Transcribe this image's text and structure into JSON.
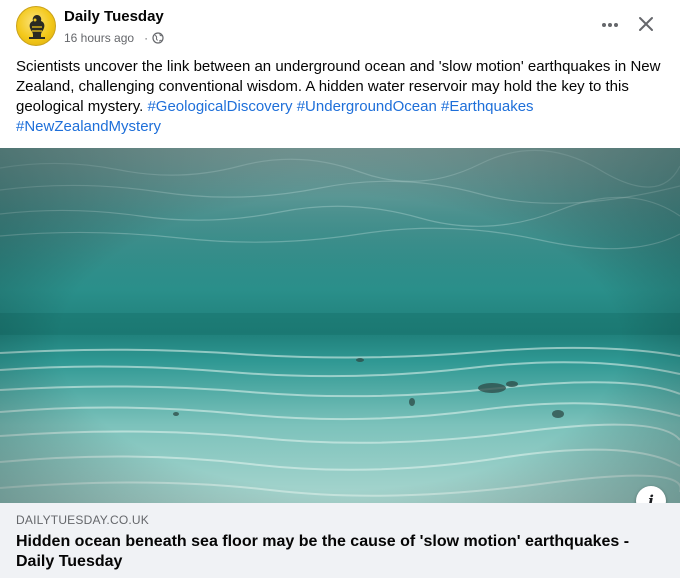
{
  "post": {
    "author": "Daily Tuesday",
    "timestamp": "16 hours ago",
    "separator": "·",
    "audience_icon": "globe-icon",
    "menu_icon": "more-dots-icon",
    "close_icon": "close-icon",
    "caption": {
      "text": "Scientists uncover the link between an underground ocean and 'slow motion' earthquakes in New Zealand, challenging conventional wisdom. A hidden water reservoir may hold the key to this geological mystery. ",
      "hashtags": [
        "#GeologicalDiscovery",
        "#UndergroundOcean",
        "#Earthquakes",
        "#NewZealandMystery"
      ]
    }
  },
  "link_preview": {
    "image_subject": "underwater ocean floor",
    "domain": "DAILYTUESDAY.CO.UK",
    "title": "Hidden ocean beneath sea floor may be the cause of 'slow motion' earthquakes - Daily Tuesday",
    "info_icon": "info-icon"
  },
  "colors": {
    "hashtag": "#1e6fd9",
    "secondary_text": "#65676b",
    "footer_bg": "#f0f2f5",
    "avatar_bg": "#f3c81a"
  }
}
